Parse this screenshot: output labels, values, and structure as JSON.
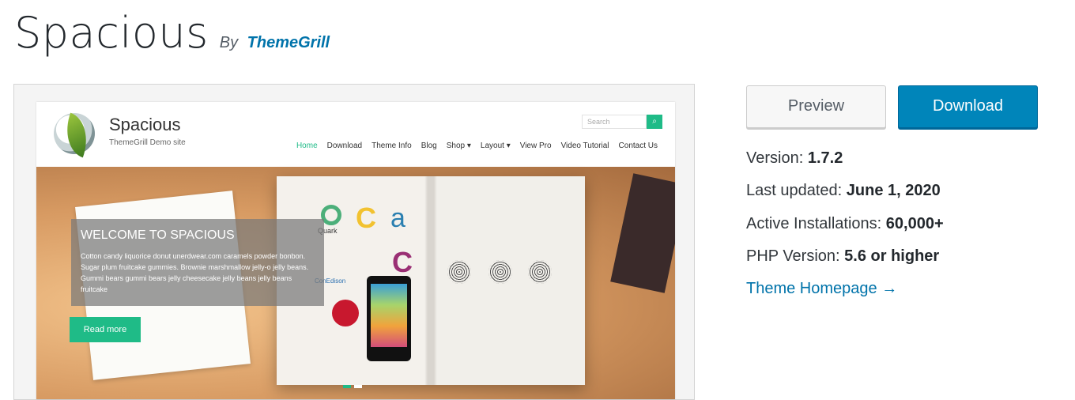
{
  "theme": {
    "name": "Spacious",
    "by_label": "By",
    "author": "ThemeGrill"
  },
  "preview_site": {
    "site_title": "Spacious",
    "tagline": "ThemeGrill Demo site",
    "search_placeholder": "Search",
    "nav": [
      "Home",
      "Download",
      "Theme Info",
      "Blog",
      "Shop ▾",
      "Layout ▾",
      "View Pro",
      "Video Tutorial",
      "Contact Us"
    ],
    "slider": {
      "title": "WELCOME TO SPACIOUS",
      "text": "Cotton candy liquorice donut unerdwear.com caramels powder bonbon. Sugar plum fruitcake gummies. Brownie marshmallow jelly-o jelly beans. Gummi bears gummi bears jelly cheesecake jelly beans jelly beans fruitcake",
      "button": "Read more"
    },
    "logos": [
      "Quark",
      "ConEdison"
    ]
  },
  "actions": {
    "preview": "Preview",
    "download": "Download"
  },
  "meta": {
    "version_label": "Version:",
    "version": "1.7.2",
    "updated_label": "Last updated:",
    "updated": "June 1, 2020",
    "installs_label": "Active Installations:",
    "installs": "60,000+",
    "php_label": "PHP Version:",
    "php": "5.6 or higher",
    "homepage": "Theme Homepage →"
  },
  "colors": {
    "accent": "#0085ba",
    "link": "#0073aa",
    "demo_green": "#1fbb87"
  }
}
